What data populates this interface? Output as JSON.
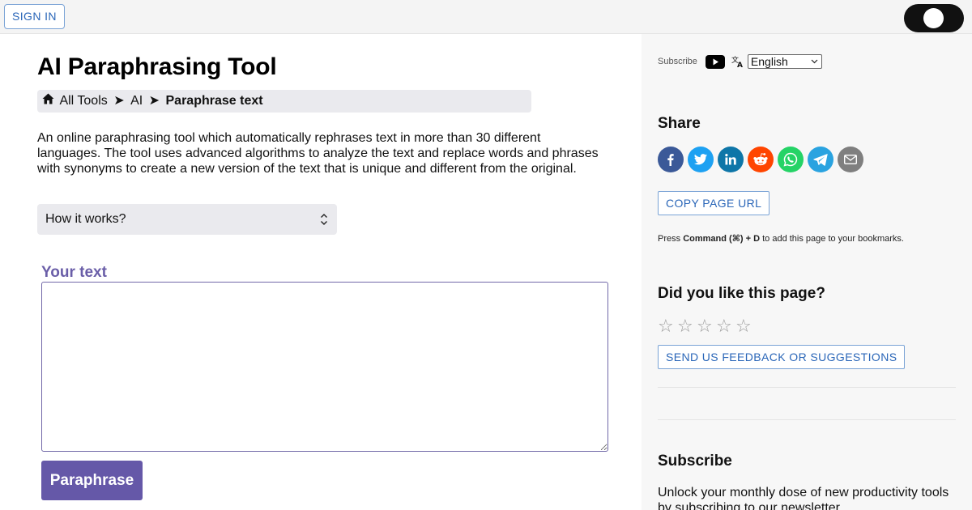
{
  "topbar": {
    "signin_label": "SIGN IN"
  },
  "main": {
    "title": "AI Paraphrasing Tool",
    "breadcrumb": {
      "home_icon": "house-icon",
      "items": [
        "All Tools",
        "AI",
        "Paraphrase text"
      ],
      "separator": "➤"
    },
    "description": "An online paraphrasing tool which automatically rephrases text in more than 30 different languages. The tool uses advanced algorithms to analyze the text and replace words and phrases with synonyms to create a new version of the text that is unique and different from the original.",
    "how_it_works_label": "How it works?",
    "your_text_label": "Your text",
    "textarea_value": "",
    "paraphrase_label": "Paraphrase"
  },
  "sidebar": {
    "subscribe_label": "Subscribe",
    "language_selected": "English",
    "share_heading": "Share",
    "share_buttons": [
      {
        "name": "facebook",
        "color": "#3b5998"
      },
      {
        "name": "twitter",
        "color": "#1da1f2"
      },
      {
        "name": "linkedin",
        "color": "#0e76a8"
      },
      {
        "name": "reddit",
        "color": "#ff4500"
      },
      {
        "name": "whatsapp",
        "color": "#25d366"
      },
      {
        "name": "telegram",
        "color": "#2aa3e0"
      },
      {
        "name": "email",
        "color": "#7f7f7f"
      }
    ],
    "copy_url_label": "COPY PAGE URL",
    "bookmark_prefix": "Press ",
    "bookmark_keys": "Command (⌘) + D",
    "bookmark_suffix": " to add this page to your bookmarks.",
    "like_heading": "Did you like this page?",
    "rating": 0,
    "stars_total": 5,
    "feedback_label": "SEND US FEEDBACK OR SUGGESTIONS",
    "subscribe_heading": "Subscribe",
    "subscribe_text": "Unlock your monthly dose of new productivity tools by subscribing to our newsletter."
  },
  "colors": {
    "accent": "#6558a8",
    "link_blue": "#2a66b8"
  }
}
